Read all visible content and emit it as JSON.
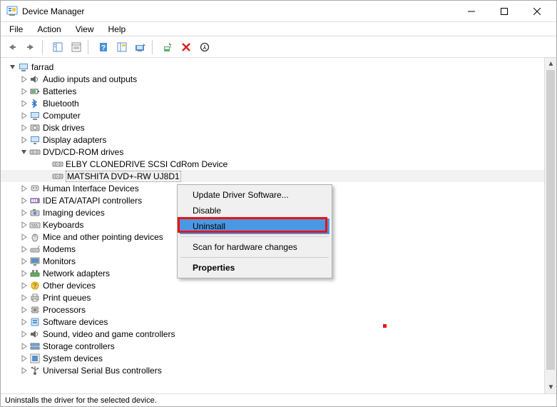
{
  "window": {
    "title": "Device Manager"
  },
  "menu": {
    "file": "File",
    "action": "Action",
    "view": "View",
    "help": "Help"
  },
  "root": "farrad",
  "categories": [
    {
      "label": "Audio inputs and outputs",
      "icon": "speaker"
    },
    {
      "label": "Batteries",
      "icon": "battery"
    },
    {
      "label": "Bluetooth",
      "icon": "bluetooth"
    },
    {
      "label": "Computer",
      "icon": "computer"
    },
    {
      "label": "Disk drives",
      "icon": "harddisk"
    },
    {
      "label": "Display adapters",
      "icon": "display"
    },
    {
      "label": "DVD/CD-ROM drives",
      "icon": "optical",
      "expanded": true,
      "children": [
        {
          "label": "ELBY CLONEDRIVE SCSI CdRom Device",
          "icon": "optical"
        },
        {
          "label": "MATSHITA DVD+-RW UJ8D1",
          "icon": "optical",
          "selected": true
        }
      ]
    },
    {
      "label": "Human Interface Devices",
      "icon": "hid"
    },
    {
      "label": "IDE ATA/ATAPI controllers",
      "icon": "ide"
    },
    {
      "label": "Imaging devices",
      "icon": "camera"
    },
    {
      "label": "Keyboards",
      "icon": "keyboard"
    },
    {
      "label": "Mice and other pointing devices",
      "icon": "mouse"
    },
    {
      "label": "Modems",
      "icon": "modem"
    },
    {
      "label": "Monitors",
      "icon": "monitor"
    },
    {
      "label": "Network adapters",
      "icon": "network"
    },
    {
      "label": "Other devices",
      "icon": "other"
    },
    {
      "label": "Print queues",
      "icon": "printer"
    },
    {
      "label": "Processors",
      "icon": "cpu"
    },
    {
      "label": "Software devices",
      "icon": "software"
    },
    {
      "label": "Sound, video and game controllers",
      "icon": "sound"
    },
    {
      "label": "Storage controllers",
      "icon": "storage"
    },
    {
      "label": "System devices",
      "icon": "system"
    },
    {
      "label": "Universal Serial Bus controllers",
      "icon": "usb",
      "cut": true
    }
  ],
  "context_menu": {
    "items": [
      {
        "label": "Update Driver Software..."
      },
      {
        "label": "Disable"
      },
      {
        "label": "Uninstall",
        "highlight": true,
        "annot": true
      }
    ],
    "scan": "Scan for hardware changes",
    "properties": "Properties"
  },
  "status": "Uninstalls the driver for the selected device."
}
